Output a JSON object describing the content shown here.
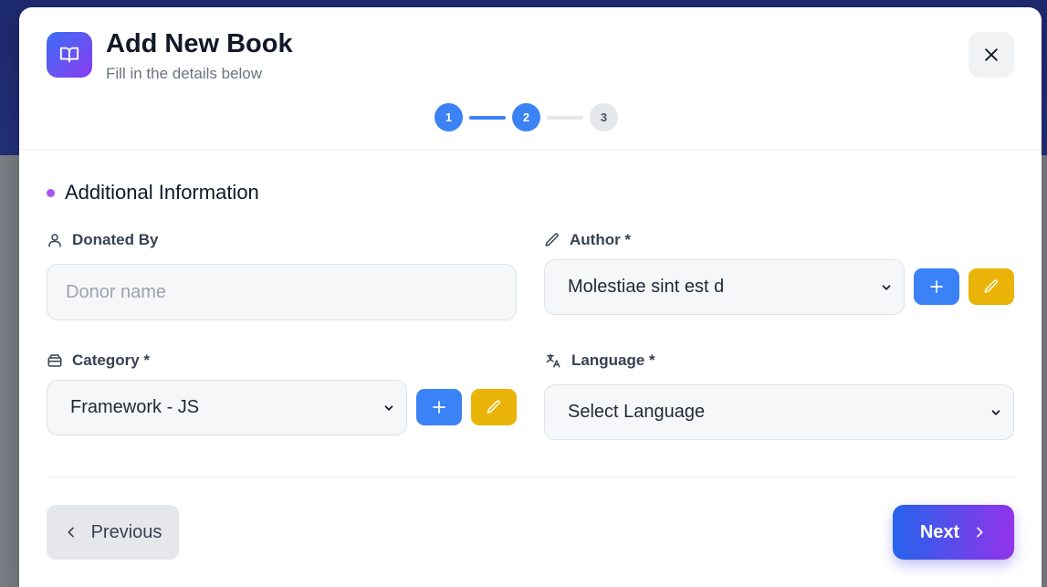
{
  "modal": {
    "title": "Add New Book",
    "subtitle": "Fill in the details below",
    "header_icon": "open-book-icon",
    "close_icon": "close-icon"
  },
  "stepper": {
    "steps": [
      {
        "label": "1",
        "state": "active"
      },
      {
        "label": "2",
        "state": "active"
      },
      {
        "label": "3",
        "state": "inactive"
      }
    ],
    "current_step": 2
  },
  "section": {
    "title": "Additional Information"
  },
  "fields": {
    "donated_by": {
      "label": "Donated By",
      "icon": "user-icon",
      "value": "",
      "placeholder": "Donor name"
    },
    "author": {
      "label": "Author *",
      "icon": "pencil-icon",
      "value": "Molestiae sint est d"
    },
    "category": {
      "label": "Category *",
      "icon": "archive-icon",
      "value": "Framework - JS"
    },
    "language": {
      "label": "Language *",
      "icon": "translate-icon",
      "value": "Select Language"
    }
  },
  "buttons": {
    "previous": "Previous",
    "next": "Next"
  },
  "colors": {
    "accent_blue": "#3b82f6",
    "edit_yellow": "#eab308",
    "section_dot": "#a855f7",
    "gradient_start": "#2563eb",
    "gradient_end": "#9333ea"
  }
}
